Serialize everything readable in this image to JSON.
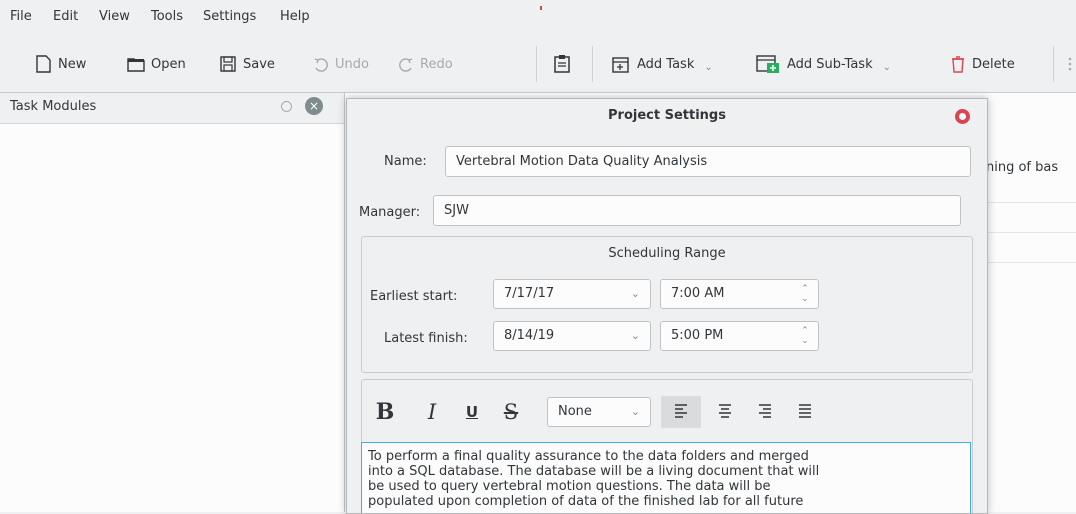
{
  "menubar": {
    "items": [
      "File",
      "Edit",
      "View",
      "Tools",
      "Settings",
      "Help"
    ]
  },
  "toolbar": {
    "new": "New",
    "open": "Open",
    "save": "Save",
    "undo": "Undo",
    "redo": "Redo",
    "add_task": "Add Task",
    "add_subtask": "Add Sub-Task",
    "delete": "Delete"
  },
  "dock": {
    "title": "Task Modules"
  },
  "background": {
    "right_text": "ning of bas"
  },
  "dialog": {
    "title": "Project Settings",
    "name_label": "Name:",
    "name_value": "Vertebral Motion Data Quality Analysis",
    "manager_label": "Manager:",
    "manager_value": "SJW",
    "scheduling_title": "Scheduling Range",
    "earliest_label": "Earliest start:",
    "earliest_date": "7/17/17",
    "earliest_time": "7:00 AM",
    "latest_label": "Latest finish:",
    "latest_date": "8/14/19",
    "latest_time": "5:00 PM",
    "format": {
      "bold": "B",
      "italic": "I",
      "underline": "U",
      "strike": "S",
      "list_style": "None"
    },
    "description": [
      "To perform a final quality assurance to the data folders and merged",
      "into a SQL database. The database will be a living document that will",
      "be used to query vertebral motion questions. The data will be",
      "populated upon completion of data of the finished lab for all future"
    ]
  },
  "colors": {
    "accent": "#3daee9",
    "close_red": "#da4453",
    "window_bg": "#eff0f1",
    "view_bg": "#fcfcfc"
  }
}
